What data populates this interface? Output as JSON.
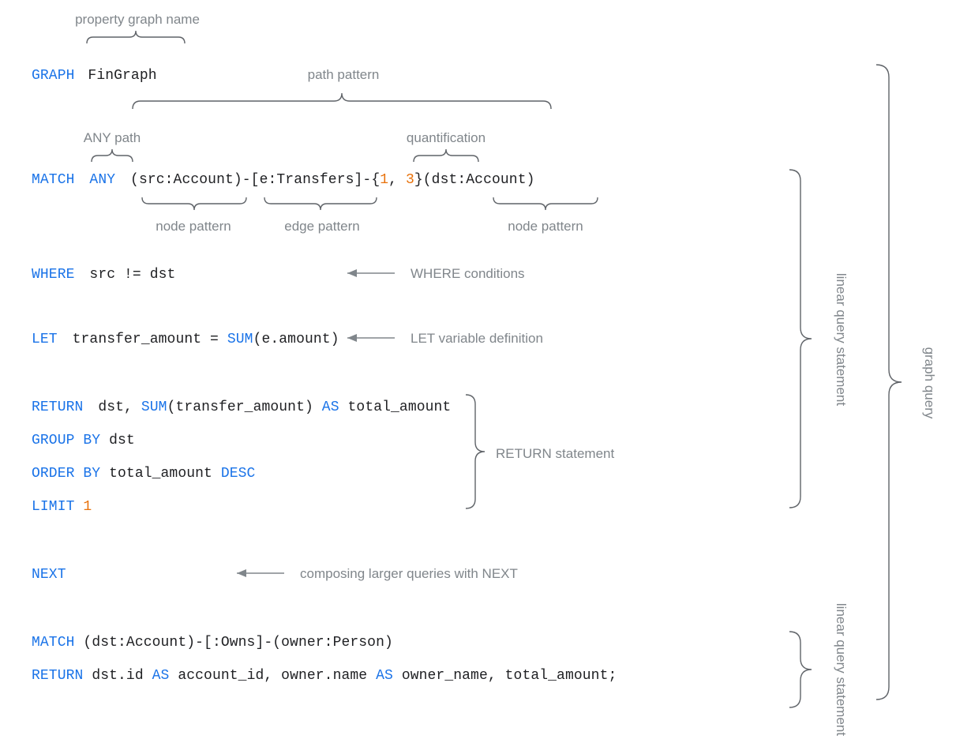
{
  "labels": {
    "property_graph_name": "property graph name",
    "path_pattern": "path pattern",
    "any_path": "ANY path",
    "quantification": "quantification",
    "node_pattern": "node pattern",
    "edge_pattern": "edge pattern",
    "where_conditions": "WHERE conditions",
    "let_def": "LET variable definition",
    "return_stmt": "RETURN statement",
    "composing_next": "composing larger queries with NEXT",
    "linear_query_statement": "linear query statement",
    "graph_query": "graph query"
  },
  "code": {
    "l1": {
      "kw_graph": "GRAPH",
      "graph_name": "FinGraph"
    },
    "l2": {
      "kw_match": "MATCH",
      "kw_any": "ANY",
      "src_open": "(src:Account)-[e:Transfers]-{",
      "n1": "1",
      "comma": ", ",
      "n3": "3",
      "close": "}(dst:Account)"
    },
    "l2_parts": {
      "open1": "(",
      "src": "src:Account",
      "close1": ")-[",
      "edge": "e:Transfers",
      "close2": "]-{",
      "num1": "1",
      "comma": ", ",
      "num3": "3",
      "close3": "}(",
      "dst": "dst:Account",
      "close4": ")"
    },
    "l3": {
      "kw_where": "WHERE",
      "rest": "src != dst"
    },
    "l4": {
      "kw_let": "LET",
      "var": "transfer_amount = ",
      "kw_sum": "SUM",
      "paren": "(e.amount)"
    },
    "l5": {
      "kw_return": "RETURN",
      "a": "dst, ",
      "kw_sum": "SUM",
      "b": "(transfer_amount) ",
      "kw_as": "AS",
      "c": " total_amount"
    },
    "l6": {
      "kw": "GROUP BY",
      "rest": " dst"
    },
    "l7": {
      "kw": "ORDER BY",
      "rest": " total_amount ",
      "kw2": "DESC"
    },
    "l8": {
      "kw": "LIMIT",
      "sp": " ",
      "num": "1"
    },
    "l9": {
      "kw": "NEXT"
    },
    "l10": {
      "kw_match": "MATCH",
      "rest": " (dst:Account)-[:Owns]-(owner:Person)"
    },
    "l11": {
      "kw_return": "RETURN",
      "a": " dst.id ",
      "kw_as1": "AS",
      "b": " account_id, owner.name ",
      "kw_as2": "AS",
      "c": " owner_name, total_amount;"
    }
  }
}
